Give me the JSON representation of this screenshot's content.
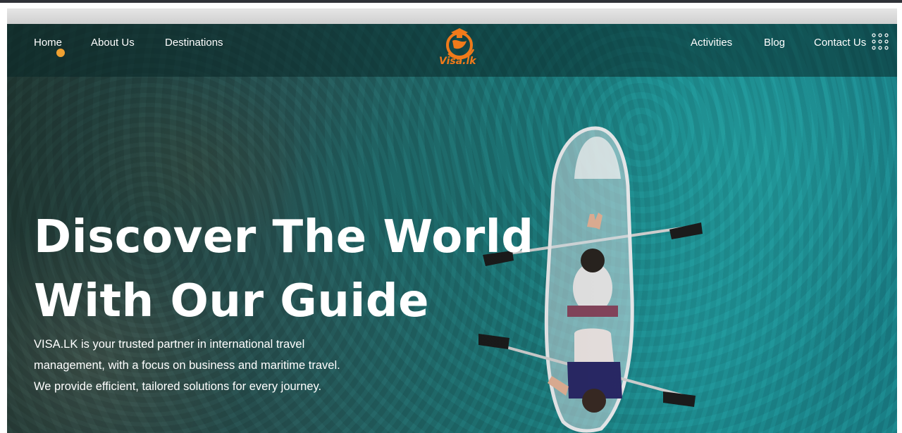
{
  "brand": {
    "logo_text": "Visa.lk",
    "accent_color": "#f07a1a",
    "active_dot_color": "#f0a132"
  },
  "nav": {
    "left_items": [
      {
        "label": "Home",
        "active": true
      },
      {
        "label": "About Us"
      },
      {
        "label": "Destinations"
      }
    ],
    "right_items": [
      {
        "label": "Activities"
      },
      {
        "label": "Blog"
      },
      {
        "label": "Contact Us"
      }
    ],
    "menu_icon": "grid-dots-icon"
  },
  "hero": {
    "title_line1": "Discover The World",
    "title_line2": "With Our Guide",
    "description": "VISA.LK is your trusted partner in international travel management, with a focus on business and maritime travel. We provide efficient, tailored solutions for every journey.",
    "background_image": "aerial-kayak-turquoise-sea"
  }
}
